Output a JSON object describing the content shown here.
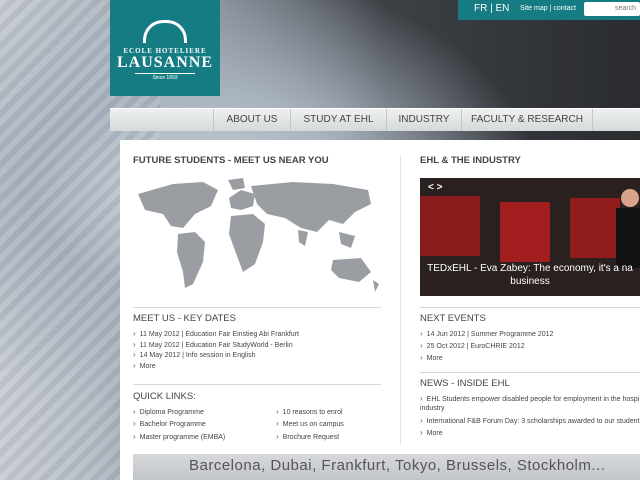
{
  "logo": {
    "line1": "ECOLE HOTELIERE",
    "line2": "LAUSANNE",
    "line3": "Since 1893"
  },
  "topbar": {
    "lang": "FR | EN",
    "links": "Site map | contact",
    "search_placeholder": "search"
  },
  "nav": [
    "ABOUT US",
    "STUDY AT EHL",
    "INDUSTRY",
    "FACULTY & RESEARCH"
  ],
  "left": {
    "title": "FUTURE STUDENTS - MEET US NEAR YOU",
    "keydates_title": "MEET US - KEY DATES",
    "keydates": [
      "11 May 2012 | Education Fair Einstieg Abi Frankfurt",
      "11 May 2012 | Education Fair StudyWorld - Berlin",
      "14 May 2012 | Info session in English"
    ],
    "more": "More",
    "quick_title": "QUICK LINKS:",
    "quick_col1": [
      "Diploma Programme",
      "Bachelor Programme",
      "Master programme (EMBA)"
    ],
    "quick_col2": [
      "10 reasons to enrol",
      "Meet us on campus",
      "Brochure Request"
    ]
  },
  "right": {
    "title": "EHL & THE INDUSTRY",
    "video_arrows": "< >",
    "video_caption": "TEDxEHL - Eva Zabey: The economy, it's a na business",
    "events_title": "NEXT EVENTS",
    "events": [
      "14 Jun 2012 | Summer Programme 2012",
      "25 Oct 2012 | EuroCHRIE 2012"
    ],
    "events_more": "More",
    "news_title": "NEWS - INSIDE EHL",
    "news": [
      "EHL Students empower disabled people for employment in the hospi industry",
      "International F&B Forum Day: 3 scholarships awarded to our student"
    ],
    "news_more": "More"
  },
  "bottom_banner": "Barcelona, Dubai, Frankfurt, Tokyo, Brussels, Stockholm...",
  "colors": {
    "brand": "#157c83"
  }
}
